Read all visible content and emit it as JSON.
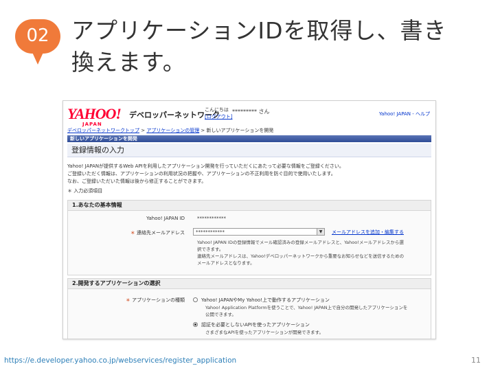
{
  "slide": {
    "number": "02",
    "title_line1": "アプリケーションIDを取得し、書き",
    "title_line2": "換えます。",
    "source_url": "https://e.developer.yahoo.co.jp/webservices/register_application",
    "page_number": "11"
  },
  "screenshot": {
    "logo_text": "YAHOO!",
    "logo_sub": "JAPAN",
    "dev_network_title": "デベロッパーネットワーク",
    "greeting_prefix": "こんにちは",
    "greeting_link": "[ログアウト]",
    "user_name": "*********",
    "user_suffix": "さん",
    "top_links": "Yahoo! JAPAN - ヘルプ",
    "breadcrumb": {
      "link1": "デベロッパーネットワークトップ",
      "sep1": " > ",
      "link2": "アプリケーションの管理",
      "sep2": " > ",
      "current": "新しいアプリケーションを開発"
    },
    "bar_title": "新しいアプリケーションを開発",
    "section_title": "登録情報の入力",
    "intro_line1": "Yahoo! JAPANが提供するWeb APIを利用したアプリケーション開発を行っていただくにあたって必要な情報をご登録ください。",
    "intro_line2": "ご登録いただく情報は、アプリケーションの利用状況の把握や、アプリケーションの不正利用を防ぐ目的で使用いたします。",
    "intro_line3": "なお、ご登録いただいた情報は後から修正することができます。",
    "required_note": "＊ 入力必須項目",
    "panel1": {
      "header": "1.あなたの基本情報",
      "id_label": "Yahoo! JAPAN ID",
      "id_value": "************",
      "email_label": "連絡先メールアドレス",
      "email_value": "************",
      "email_link": "メールアドレスを追加・編集する",
      "note_line1": "Yahoo! JAPAN IDの登録情報でメール確認済みの登録メールアドレスと、Yahoo!メールアドレスから選",
      "note_line2": "択できます。",
      "note_line3": "連絡先メールアドレスは、Yahoo!デベロッパーネットワークから重要なお知らせなどを送信するための",
      "note_line4": "メールアドレスとなります。"
    },
    "panel2": {
      "header": "2.開発するアプリケーションの選択",
      "type_label": "アプリケーションの種類",
      "option1": "Yahoo! JAPANやMy Yahoo!上で動作するアプリケーション",
      "option1_note1": "Yahoo! Application Platformを使うことで、Yahoo! JAPAN上で自分の開発したアプリケーションを",
      "option1_note2": "公開できます。",
      "option2": "認証を必要としないAPIを使ったアプリケーション",
      "option2_note": "さまざまなAPIを使ったアプリケーションが開発できます。"
    },
    "required_mark": "＊"
  },
  "colors": {
    "badge": "#f07a3a",
    "yahoo_red": "#ff0033",
    "link_blue": "#0033cc",
    "bar_blue": "#2f4c96",
    "url_blue": "#2d7fb8"
  }
}
